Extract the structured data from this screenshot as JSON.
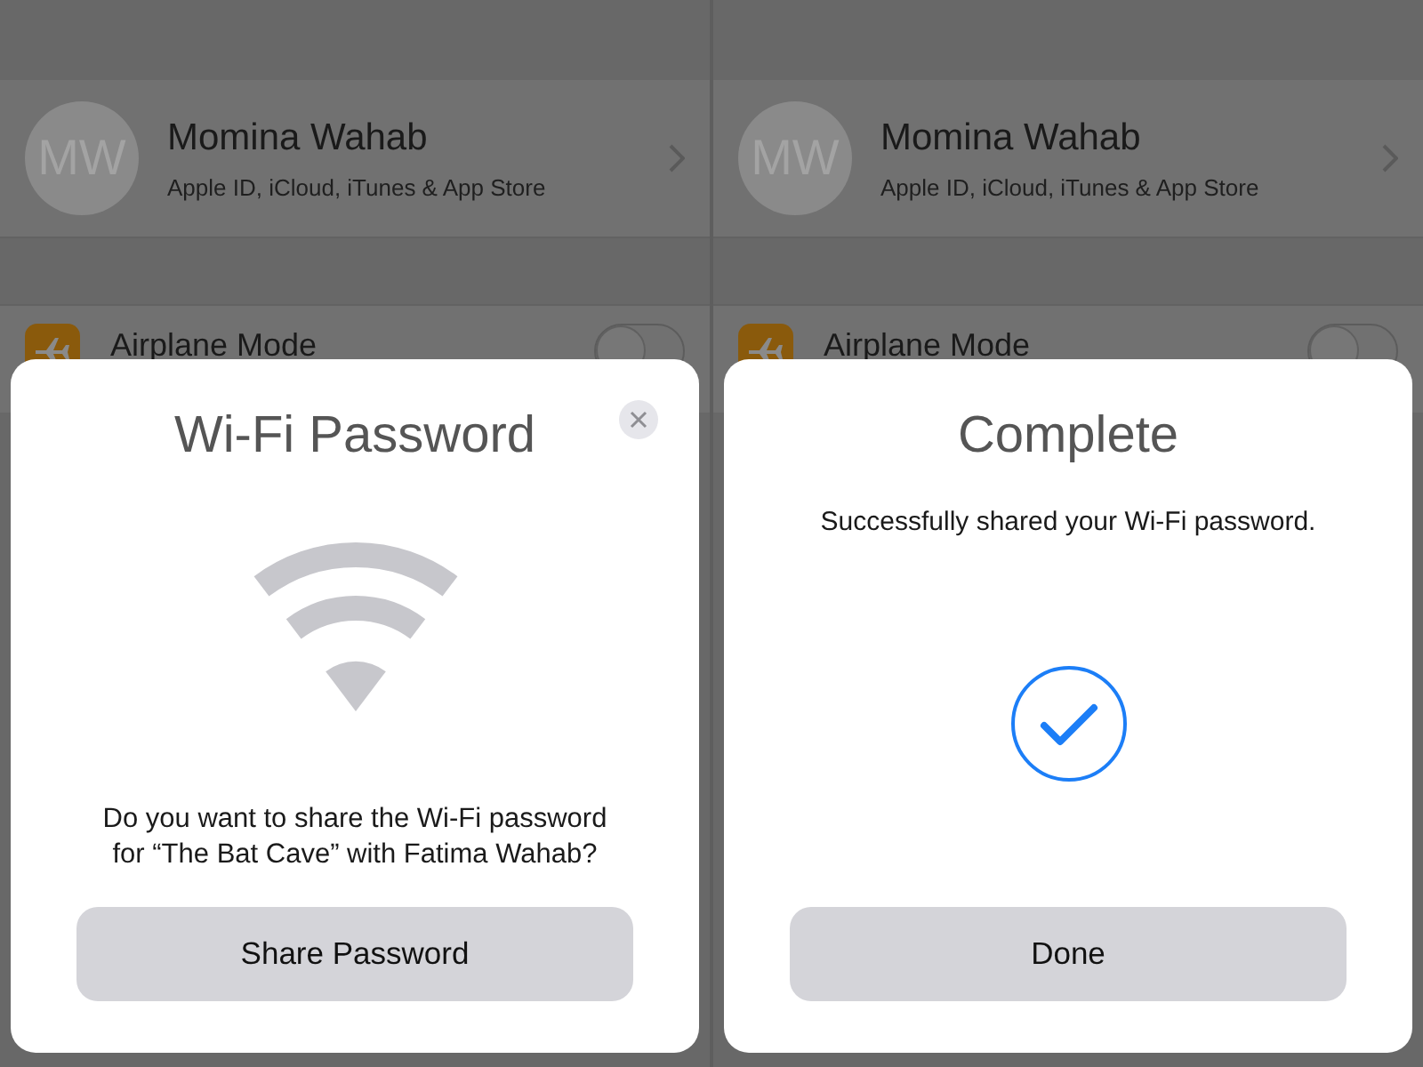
{
  "panels": [
    {
      "profile": {
        "initials": "MW",
        "name": "Momina Wahab",
        "subtitle": "Apple ID, iCloud, iTunes & App Store"
      },
      "settings_rows": [
        {
          "label": "Airplane Mode",
          "on": false
        }
      ],
      "dialog": {
        "kind": "share",
        "title": "Wi-Fi Password",
        "message": "Do you want to share the Wi-Fi password for “The Bat Cave” with Fatima Wahab?",
        "button": "Share Password"
      }
    },
    {
      "profile": {
        "initials": "MW",
        "name": "Momina Wahab",
        "subtitle": "Apple ID, iCloud, iTunes & App Store"
      },
      "settings_rows": [
        {
          "label": "Airplane Mode",
          "on": false
        }
      ],
      "dialog": {
        "kind": "complete",
        "title": "Complete",
        "message": "Successfully shared your Wi-Fi password.",
        "button": "Done"
      }
    }
  ]
}
